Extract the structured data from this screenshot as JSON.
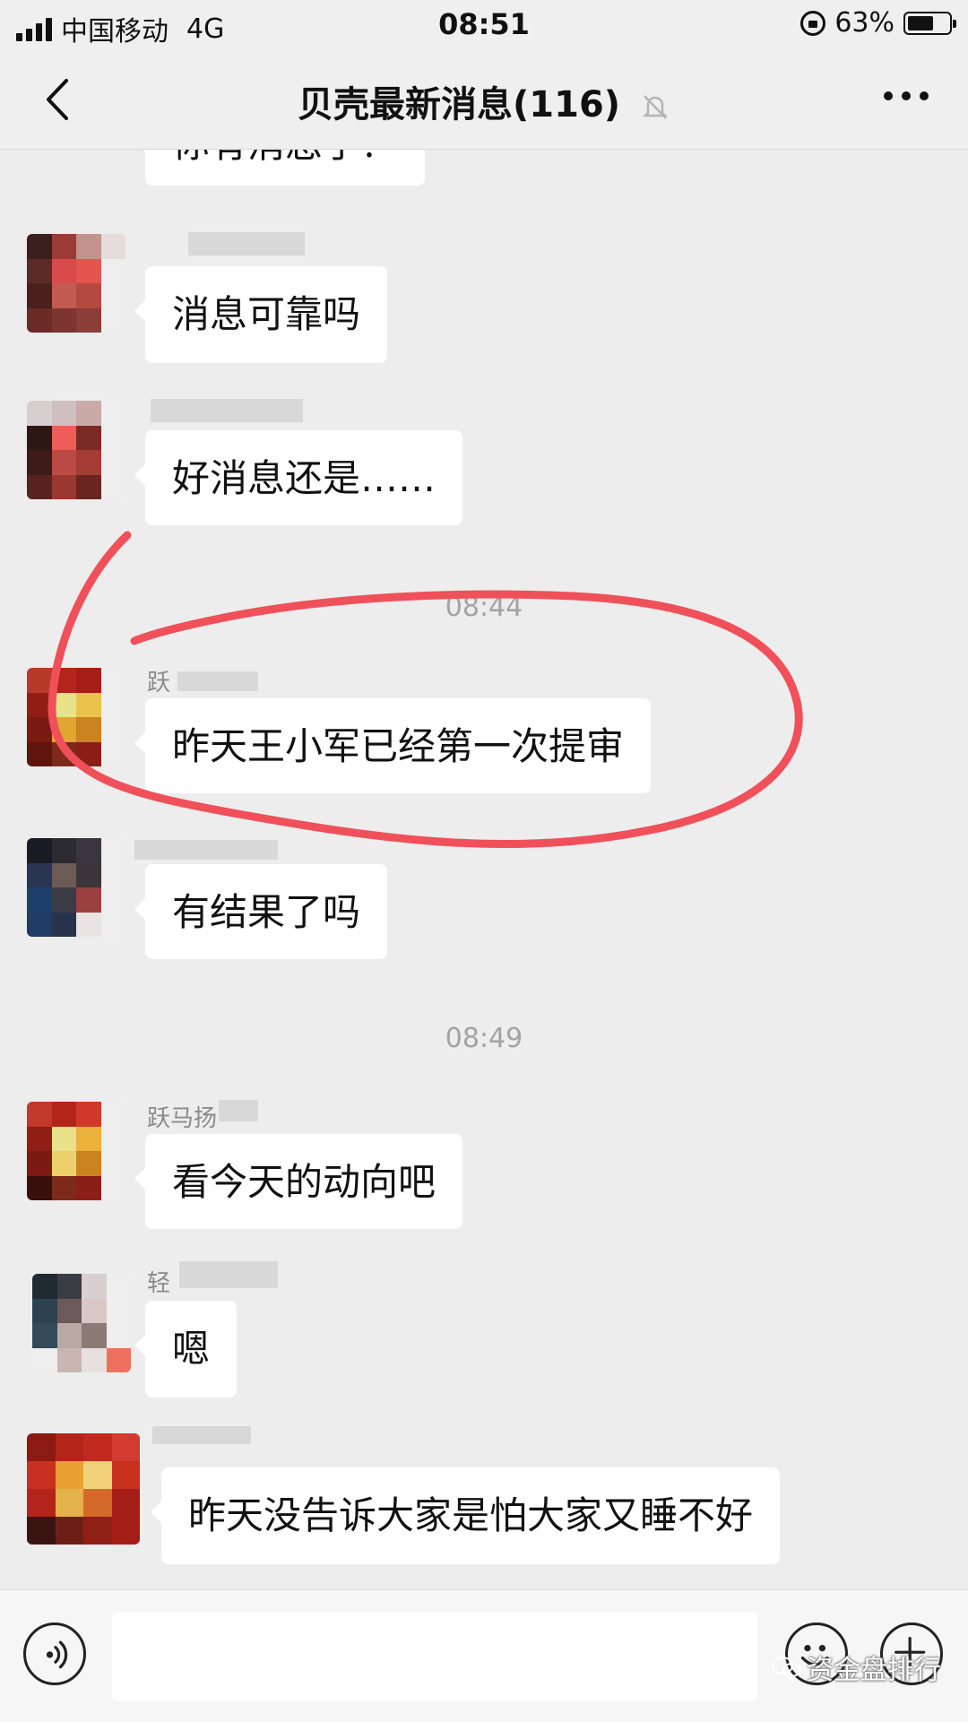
{
  "status_bar": {
    "carrier": "中国移动",
    "network": "4G",
    "time": "08:51",
    "battery": "63%",
    "battery_level": 0.63
  },
  "nav": {
    "title": "贝壳最新消息(116)",
    "back_icon": "chevron-left-icon",
    "mute_icon": "bell-off-icon",
    "more_icon": "more-dots-icon"
  },
  "timestamps": {
    "t1": "08:44",
    "t2": "08:49"
  },
  "messages": [
    {
      "text": "你有消息了？",
      "sender": ""
    },
    {
      "text": "消息可靠吗",
      "sender": ""
    },
    {
      "text": "好消息还是……",
      "sender": ""
    },
    {
      "text": "昨天王小军已经第一次提审",
      "sender": "跃"
    },
    {
      "text": "有结果了吗",
      "sender": ""
    },
    {
      "text": "看今天的动向吧",
      "sender": "跃马扬"
    },
    {
      "text": "嗯",
      "sender": "轻"
    },
    {
      "text": "昨天没告诉大家是怕大家又睡不好",
      "sender": ""
    }
  ],
  "input_bar": {
    "voice_icon": "voice-icon",
    "emoji_icon": "emoji-icon",
    "plus_icon": "plus-icon"
  },
  "watermark": "资金盘排行",
  "colors": {
    "background": "#ededed",
    "bubble": "#ffffff",
    "annotation_red": "#f0505a",
    "timestamp": "#a3a3a3"
  }
}
